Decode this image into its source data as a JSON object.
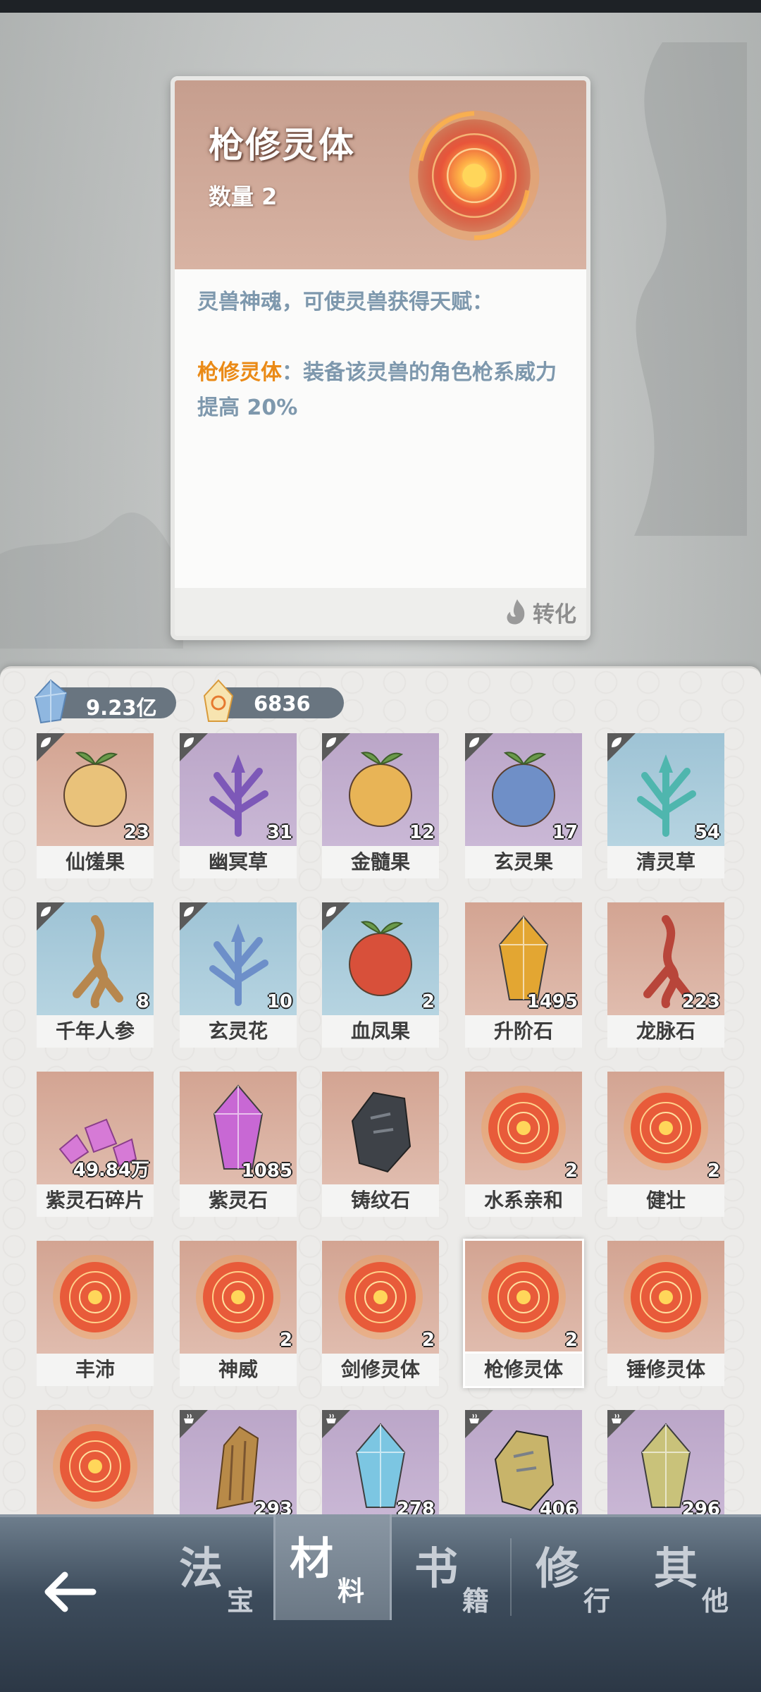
{
  "detail": {
    "title": "枪修灵体",
    "quantity": "数量 2",
    "desc_line1": "灵兽神魂，可使灵兽获得天赋：",
    "talent_name": "枪修灵体",
    "talent_desc": "：装备该灵兽的角色枪系威力提高 20%",
    "convert_label": "转化",
    "convert_icon": "flame-icon"
  },
  "currency": [
    {
      "icon": "blue-crystal-icon",
      "value": "9.23亿"
    },
    {
      "icon": "gold-crystal-icon",
      "value": "6836"
    }
  ],
  "items": [
    {
      "name": "仙馐果",
      "count": "23",
      "bg": "peach",
      "art": "fruit",
      "color": "#e9c27a",
      "corner": "leaf"
    },
    {
      "name": "幽冥草",
      "count": "31",
      "bg": "purple",
      "art": "herb",
      "color": "#7d58b8",
      "corner": "leaf"
    },
    {
      "name": "金髓果",
      "count": "12",
      "bg": "purple",
      "art": "fruit",
      "color": "#e8b456",
      "corner": "leaf"
    },
    {
      "name": "玄灵果",
      "count": "17",
      "bg": "purple",
      "art": "fruit",
      "color": "#6f8fc7",
      "corner": "leaf"
    },
    {
      "name": "清灵草",
      "count": "54",
      "bg": "blue",
      "art": "herb",
      "color": "#4fb6ae",
      "corner": "leaf"
    },
    {
      "name": "千年人参",
      "count": "8",
      "bg": "blue",
      "art": "root",
      "color": "#b7874e",
      "corner": "leaf"
    },
    {
      "name": "玄灵花",
      "count": "10",
      "bg": "blue",
      "art": "herb",
      "color": "#6d8fc9",
      "corner": "leaf"
    },
    {
      "name": "血凤果",
      "count": "2",
      "bg": "blue",
      "art": "fruit",
      "color": "#d8503a",
      "corner": "leaf"
    },
    {
      "name": "升阶石",
      "count": "1495",
      "bg": "peach",
      "art": "crystal",
      "color": "#e3a632",
      "corner": ""
    },
    {
      "name": "龙脉石",
      "count": "223",
      "bg": "peach",
      "art": "root",
      "color": "#b8453a",
      "corner": ""
    },
    {
      "name": "紫灵石碎片",
      "count": "49.84万",
      "bg": "peach",
      "art": "shards",
      "color": "#d67ad6",
      "corner": ""
    },
    {
      "name": "紫灵石",
      "count": "1085",
      "bg": "peach",
      "art": "crystal",
      "color": "#c868d4",
      "corner": ""
    },
    {
      "name": "铸纹石",
      "count": "",
      "bg": "peach",
      "art": "stone",
      "color": "#3e4248",
      "corner": ""
    },
    {
      "name": "水系亲和",
      "count": "2",
      "bg": "peach",
      "art": "orb",
      "color": "#e85b3a",
      "corner": ""
    },
    {
      "name": "健壮",
      "count": "2",
      "bg": "peach",
      "art": "orb",
      "color": "#e85b3a",
      "corner": ""
    },
    {
      "name": "丰沛",
      "count": "",
      "bg": "peach",
      "art": "orb",
      "color": "#e85b3a",
      "corner": ""
    },
    {
      "name": "神威",
      "count": "2",
      "bg": "peach",
      "art": "orb",
      "color": "#e85b3a",
      "corner": ""
    },
    {
      "name": "剑修灵体",
      "count": "2",
      "bg": "peach",
      "art": "orb",
      "color": "#e85b3a",
      "corner": ""
    },
    {
      "name": "枪修灵体",
      "count": "2",
      "bg": "peach",
      "art": "orb",
      "color": "#e85b3a",
      "corner": "",
      "selected": true
    },
    {
      "name": "锤修灵体",
      "count": "",
      "bg": "peach",
      "art": "orb",
      "color": "#e85b3a",
      "corner": ""
    },
    {
      "name": "",
      "count": "",
      "bg": "peach",
      "art": "orb",
      "color": "#e85b3a",
      "corner": ""
    },
    {
      "name": "",
      "count": "293",
      "bg": "purple",
      "art": "wood",
      "color": "#b88a48",
      "corner": "cauldron"
    },
    {
      "name": "",
      "count": "278",
      "bg": "purple",
      "art": "crystal",
      "color": "#7cc6e2",
      "corner": "cauldron"
    },
    {
      "name": "",
      "count": "406",
      "bg": "purple",
      "art": "stone",
      "color": "#c8b46a",
      "corner": "cauldron"
    },
    {
      "name": "",
      "count": "296",
      "bg": "purple",
      "art": "crystal",
      "color": "#c9c27a",
      "corner": "cauldron"
    }
  ],
  "nav": {
    "back_icon": "back-arrow-icon",
    "tabs": [
      {
        "main": "法",
        "sub": "宝",
        "active": false
      },
      {
        "main": "材",
        "sub": "料",
        "active": true
      },
      {
        "main": "书",
        "sub": "籍",
        "active": false
      },
      {
        "main": "修",
        "sub": "行",
        "active": false
      },
      {
        "main": "其",
        "sub": "他",
        "active": false
      }
    ]
  }
}
